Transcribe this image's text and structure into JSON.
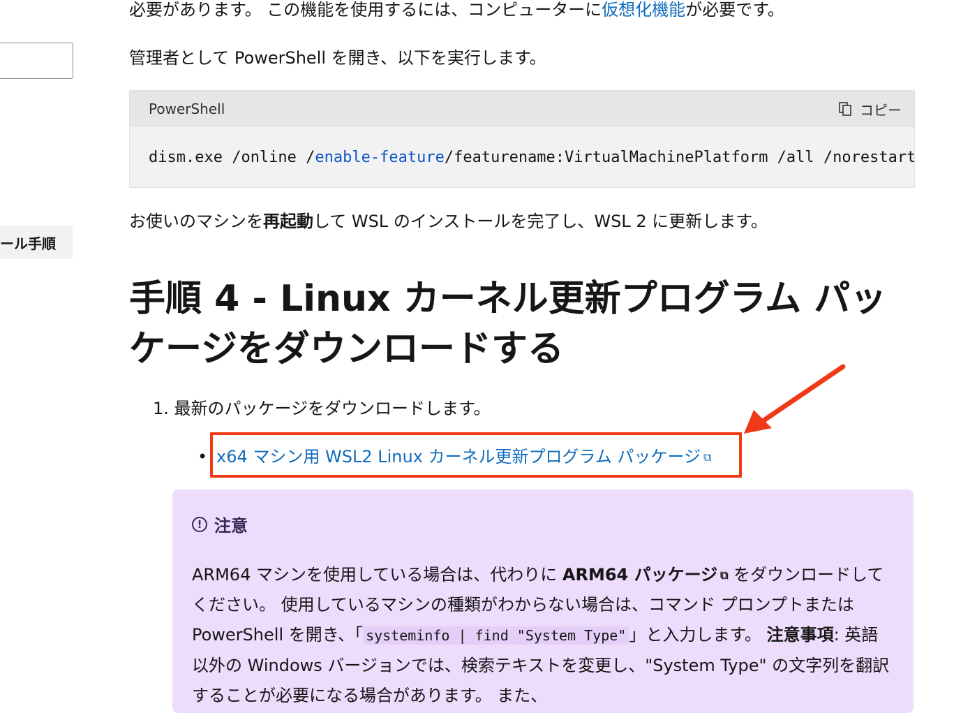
{
  "sidebar": {
    "input_value": "",
    "active_item_label": "ール手順"
  },
  "content": {
    "para1_before": "必要があります。 この機能を使用するには、コンピューターに",
    "para1_link": "仮想化機能",
    "para1_after": "が必要です。",
    "para2": "管理者として PowerShell を開き、以下を実行します。",
    "code_block": {
      "language": "PowerShell",
      "copy_label": "コピー",
      "code_part1": "dism.exe /online /",
      "code_keyword": "enable-feature",
      "code_part2": " /featurename:VirtualMachinePlatform /all /norestart"
    },
    "para3_before": "お使いのマシンを",
    "para3_bold": "再起動",
    "para3_after": "して WSL のインストールを完了し、WSL 2 に更新します。",
    "heading": "手順 4 - Linux カーネル更新プログラム パッケージをダウンロードする",
    "step1": "1. 最新のパッケージをダウンロードします。",
    "bullet": "•",
    "download_link": "x64 マシン用 WSL2 Linux カーネル更新プログラム パッケージ",
    "ext_icon": "external-link-icon",
    "note": {
      "title": "注意",
      "icon": "info-circle-icon",
      "text1": "ARM64 マシンを使用している場合は、代わりに ",
      "arm_link": "ARM64 パッケージ",
      "text2": " をダウンロードしてください。 使用しているマシンの種類がわからない場合は、コマンド プロンプトまたは PowerShell を開き、「",
      "inline_code": "systeminfo | find \"System Type\"",
      "text3": "」と入力します。 ",
      "bold_label": "注意事項",
      "text4": ": 英語以外の Windows バージョンでは、検索テキストを変更し、\"System Type\" の文字列を翻訳することが必要になる場合があります。 また、"
    }
  },
  "colors": {
    "link": "#0f6cbd",
    "highlight": "#f03a17",
    "note_bg": "#eedcfc",
    "code_bg": "#f2f2f2"
  }
}
